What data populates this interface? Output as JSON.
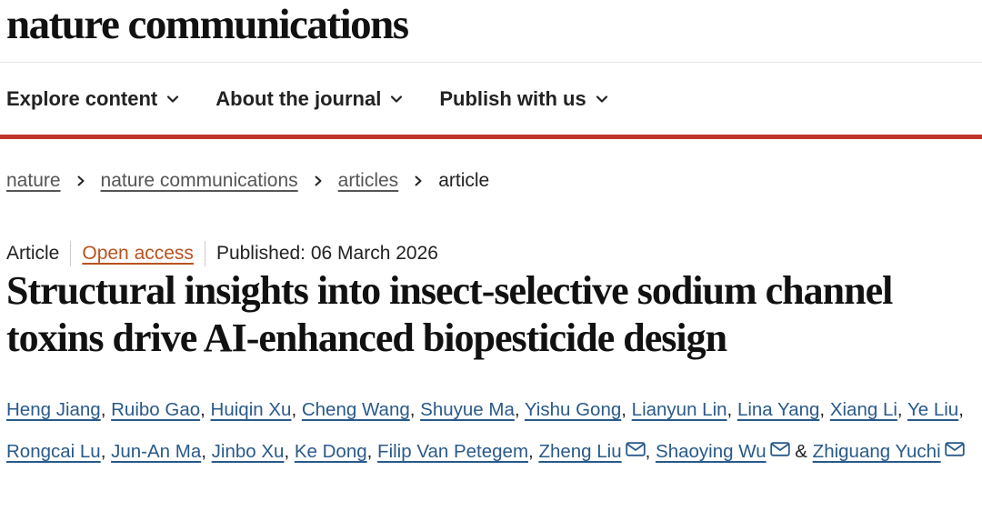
{
  "header": {
    "brand": "nature communications"
  },
  "nav": {
    "items": [
      {
        "label": "Explore content",
        "icon": "chevron-down-icon"
      },
      {
        "label": "About the journal",
        "icon": "chevron-down-icon"
      },
      {
        "label": "Publish with us",
        "icon": "chevron-down-icon"
      }
    ]
  },
  "breadcrumb": {
    "items": [
      "nature",
      "nature communications",
      "articles"
    ],
    "current": "article"
  },
  "article": {
    "type": "Article",
    "access": "Open access",
    "published": "Published: 06 March 2026",
    "title": "Structural insights into insect-selective sodium channel toxins drive AI-enhanced biopesticide design",
    "authors": [
      "Heng Jiang",
      "Ruibo Gao",
      "Huiqin Xu",
      "Cheng Wang",
      "Shuyue Ma",
      "Yishu Gong",
      "Lianyun Lin",
      "Lina Yang",
      "Xiang Li",
      "Ye Liu",
      "Rongcai Lu",
      "Jun-An Ma",
      "Jinbo Xu",
      "Ke Dong",
      "Filip Van Petegem",
      "Zheng Liu",
      "Shaoying Wu",
      "Zhiguang Yuchi"
    ],
    "corresponding_flags": [
      false,
      false,
      false,
      false,
      false,
      false,
      false,
      false,
      false,
      false,
      false,
      false,
      false,
      false,
      false,
      true,
      true,
      true
    ],
    "author_separator": ",",
    "final_conjunction": "&"
  },
  "colors": {
    "accent_bar": "#c0362c",
    "open_access": "#b8521f",
    "author_link": "#2a5a8a"
  }
}
